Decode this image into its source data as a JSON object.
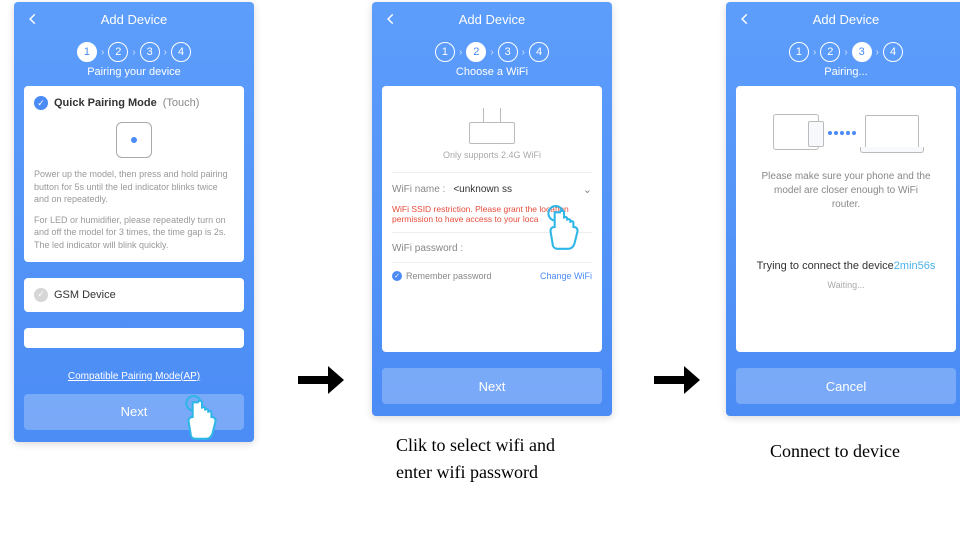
{
  "screens": {
    "s1": {
      "title": "Add Device",
      "active_step": 1,
      "subtitle": "Pairing your device",
      "quick_pairing_title": "Quick Pairing Mode",
      "quick_pairing_suffix": "(Touch)",
      "desc1": "Power up the model, then press and hold pairing button for 5s until the led indicator blinks twice and on repeatedly.",
      "desc2": "For LED or humidifier, please repeatedly turn on and off the model for 3 times, the time gap is 2s. The led indicator will blink quickly.",
      "gsm_label": "GSM Device",
      "compat_link": "Compatible Pairing Mode(AP)",
      "next": "Next"
    },
    "s2": {
      "title": "Add Device",
      "active_step": 2,
      "subtitle": "Choose a WiFi",
      "supports": "Only supports 2.4G WiFi",
      "wifi_name_label": "WiFi name :",
      "wifi_name_value": "<unknown ss",
      "ssid_warning": "WiFi SSID restriction. Please grant the location permission to have access to your loca",
      "wifi_pw_label": "WiFi password :",
      "remember": "Remember password",
      "change": "Change WiFi",
      "next": "Next"
    },
    "s3": {
      "title": "Add Device",
      "active_step": 3,
      "subtitle": "Pairing...",
      "note": "Please make sure your phone and the model are closer enough to WiFi router.",
      "status_prefix": "Trying to connect the device",
      "status_time": "2min56s",
      "waiting": "Waiting...",
      "cancel": "Cancel"
    }
  },
  "captions": {
    "c2a": "Clik to select wifi and",
    "c2b": "enter wifi password",
    "c3": "Connect to device"
  },
  "steps": [
    "1",
    "2",
    "3",
    "4"
  ]
}
